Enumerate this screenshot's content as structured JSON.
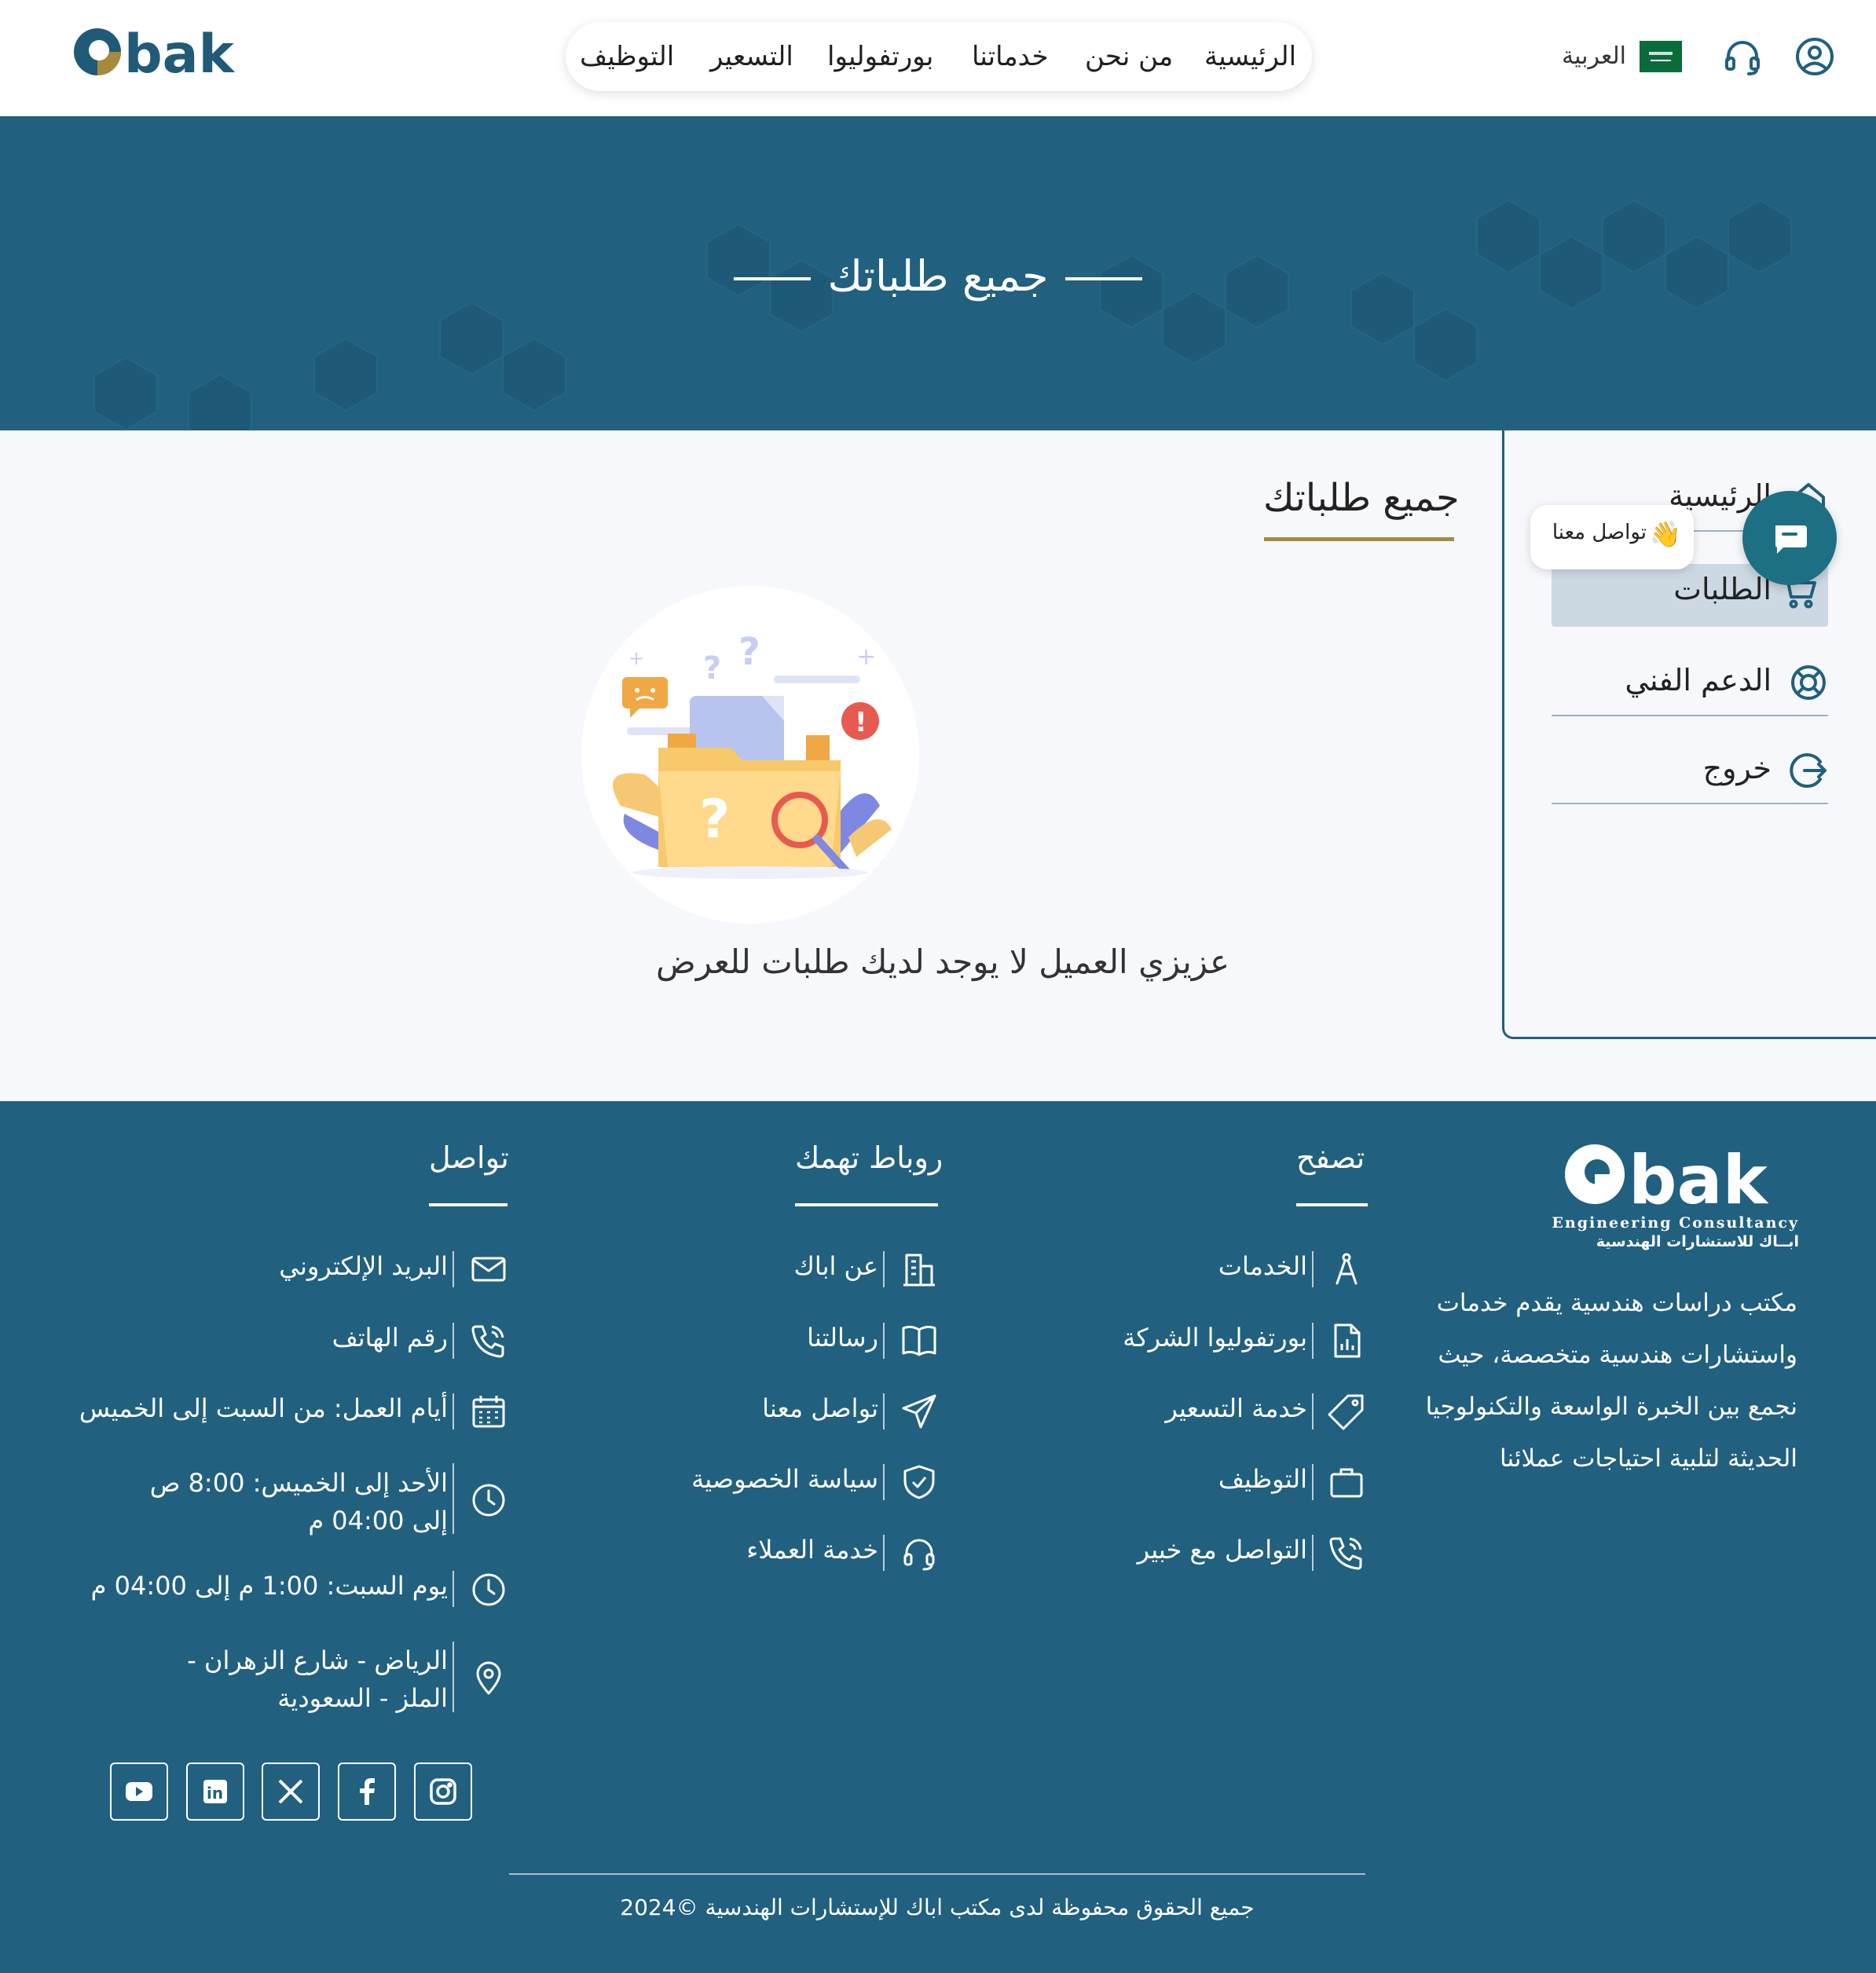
{
  "header": {
    "logo_text": "obak",
    "nav": [
      "الرئيسية",
      "من نحن",
      "خدماتنا",
      "بورتفوليوا",
      "التسعير",
      "التوظيف"
    ],
    "language": "العربية"
  },
  "banner": {
    "title": "جميع طلباتك"
  },
  "sidebar": {
    "items": [
      {
        "label": "الرئيسية",
        "icon": "home-icon"
      },
      {
        "label": "الطلبات",
        "icon": "cart-icon",
        "active": true
      },
      {
        "label": "الدعم الفني",
        "icon": "lifebuoy-icon"
      },
      {
        "label": "خروج",
        "icon": "logout-icon"
      }
    ]
  },
  "main": {
    "section_title": "جميع طلباتك",
    "empty_message": "عزيزي العميل لا يوجد لديك طلبات للعرض"
  },
  "chat": {
    "label": "تواصل معنا",
    "emoji": "👋"
  },
  "footer": {
    "logo_text": "obak",
    "logo_sub_en": "Engineering Consultancy",
    "logo_sub_ar": "ابــاك للاستشارات الهندسية",
    "description": "مكتب دراسات هندسية يقدم خدمات واستشارات هندسية متخصصة، حيث نجمع بين الخبرة الواسعة والتكنولوجيا الحديثة لتلبية احتياجات عملائنا",
    "browse": {
      "title": "تصفح",
      "items": [
        "الخدمات",
        "بورتفوليوا الشركة",
        "خدمة التسعير",
        "التوظيف",
        "التواصل مع خبير"
      ]
    },
    "links": {
      "title": "روباط تهمك",
      "items": [
        "عن اباك",
        "رسالتنا",
        "تواصل معنا",
        "سياسة الخصوصية",
        "خدمة العملاء"
      ]
    },
    "contact": {
      "title": "تواصل",
      "items": [
        "البريد الإلكتروني",
        "رقم الهاتف",
        "أيام العمل: من السبت إلى الخميس",
        "الأحد إلى الخميس: 8:00 ص إلى 04:00 م",
        "يوم السبت: 1:00 م إلى 04:00 م",
        "الرياض - شارع الزهران - الملز - السعودية"
      ]
    },
    "copyright": "جميع الحقوق محفوظة لدى مكتب اباك للإستشارات الهندسية ©2024"
  },
  "colors": {
    "primary": "#21607f",
    "accent": "#a68a3e",
    "chat": "#1d6f83"
  }
}
